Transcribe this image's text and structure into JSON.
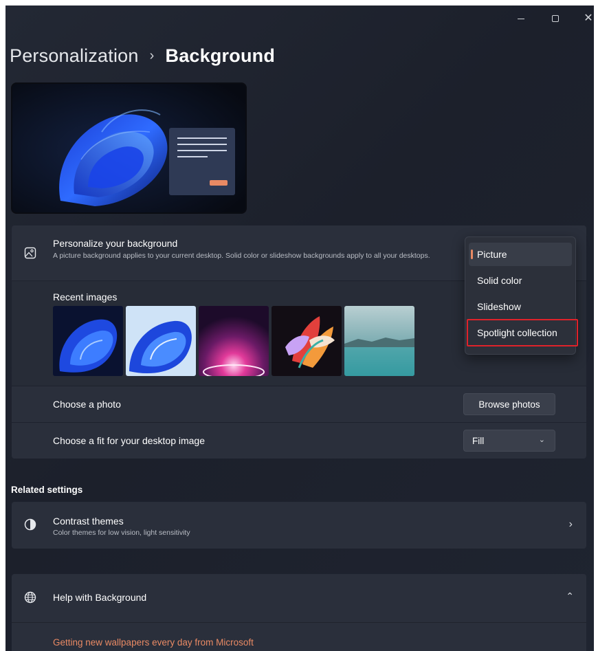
{
  "window": {
    "controls": [
      "minimize",
      "maximize",
      "close"
    ]
  },
  "header": {
    "parent": "Personalization",
    "separator": "›",
    "current": "Background"
  },
  "personalize": {
    "title": "Personalize your background",
    "description": "A picture background applies to your current desktop. Solid color or slideshow backgrounds apply to all your desktops.",
    "icon": "picture-icon"
  },
  "recent": {
    "title": "Recent images",
    "images": [
      "bloom-blue-1",
      "bloom-blue-2",
      "pink-glow",
      "colorful-flower",
      "lake-landscape"
    ]
  },
  "photo": {
    "title": "Choose a photo",
    "button": "Browse photos"
  },
  "fit": {
    "title": "Choose a fit for your desktop image",
    "value": "Fill"
  },
  "dropdown": {
    "items": [
      "Picture",
      "Solid color",
      "Slideshow",
      "Spotlight collection"
    ],
    "selected": "Picture",
    "highlighted": "Spotlight collection"
  },
  "related": {
    "label": "Related settings",
    "contrast": {
      "title": "Contrast themes",
      "description": "Color themes for low vision, light sensitivity"
    }
  },
  "help": {
    "title": "Help with Background",
    "link": "Getting new wallpapers every day from Microsoft"
  },
  "colors": {
    "accent": "#e98a64",
    "highlight_box": "#e0222a",
    "background": "#1f2430"
  }
}
